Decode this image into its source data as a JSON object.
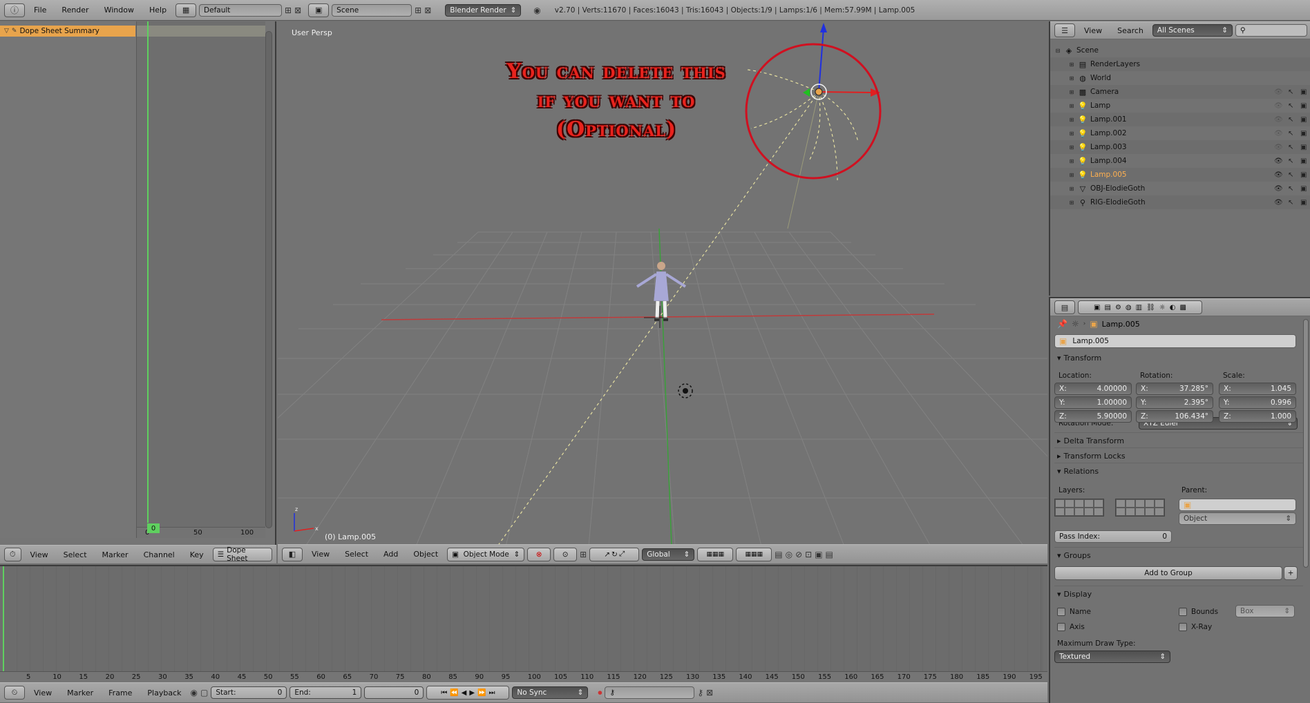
{
  "top_bar": {
    "menus": [
      "File",
      "Render",
      "Window",
      "Help"
    ],
    "screen_layout": "Default",
    "scene": "Scene",
    "render_engine": "Blender Render",
    "stats": "v2.70 | Verts:11670 | Faces:16043 | Tris:16043 | Objects:1/9 | Lamps:1/6 | Mem:57.99M | Lamp.005"
  },
  "dope_sheet": {
    "summary_label": "Dope Sheet Summary",
    "current_frame": "0",
    "ruler_ticks": [
      "0",
      "50",
      "100"
    ],
    "header_menus": [
      "View",
      "Select",
      "Marker",
      "Channel",
      "Key"
    ],
    "mode": "Dope Sheet"
  },
  "viewport": {
    "view_name": "User Persp",
    "object_label": "(0) Lamp.005",
    "callout_text": [
      "You can delete this",
      "if you want to",
      "(Optional)"
    ],
    "header_menus": [
      "View",
      "Select",
      "Add",
      "Object"
    ],
    "mode": "Object Mode",
    "transform_orientation": "Global"
  },
  "timeline": {
    "ruler_ticks": [
      "5",
      "10",
      "15",
      "20",
      "25",
      "30",
      "35",
      "40",
      "45",
      "50",
      "55",
      "60",
      "65",
      "70",
      "75",
      "80",
      "85",
      "90",
      "95",
      "100",
      "105",
      "110",
      "115",
      "120",
      "125",
      "130",
      "135",
      "140",
      "145",
      "150",
      "155",
      "160",
      "165",
      "170",
      "175",
      "180",
      "185",
      "190",
      "195"
    ],
    "header_menus": [
      "View",
      "Marker",
      "Frame",
      "Playback"
    ],
    "start_label": "Start:",
    "start_value": "0",
    "end_label": "End:",
    "end_value": "1",
    "current_frame": "0",
    "sync": "No Sync"
  },
  "outliner": {
    "header_menus": [
      "View",
      "Search"
    ],
    "scene_filter": "All Scenes",
    "items": [
      {
        "label": "Scene",
        "icon": "scene-icon",
        "indent": 0
      },
      {
        "label": "RenderLayers",
        "icon": "render-layers-icon",
        "indent": 1
      },
      {
        "label": "World",
        "icon": "world-icon",
        "indent": 1
      },
      {
        "label": "Camera",
        "icon": "camera-icon",
        "indent": 1
      },
      {
        "label": "Lamp",
        "icon": "lamp-icon",
        "indent": 1
      },
      {
        "label": "Lamp.001",
        "icon": "lamp-icon",
        "indent": 1
      },
      {
        "label": "Lamp.002",
        "icon": "lamp-icon",
        "indent": 1
      },
      {
        "label": "Lamp.003",
        "icon": "lamp-icon",
        "indent": 1
      },
      {
        "label": "Lamp.004",
        "icon": "lamp-icon",
        "indent": 1
      },
      {
        "label": "Lamp.005",
        "icon": "lamp-icon",
        "indent": 1,
        "selected": true
      },
      {
        "label": "OBJ-ElodieGoth",
        "icon": "mesh-icon",
        "indent": 1
      },
      {
        "label": "RIG-ElodieGoth",
        "icon": "armature-icon",
        "indent": 1
      }
    ]
  },
  "properties": {
    "breadcrumb_object": "Lamp.005",
    "object_name": "Lamp.005",
    "transform": {
      "title": "Transform",
      "location_label": "Location:",
      "rotation_label": "Rotation:",
      "scale_label": "Scale:",
      "location": [
        {
          "axis": "X:",
          "value": "4.00000"
        },
        {
          "axis": "Y:",
          "value": "1.00000"
        },
        {
          "axis": "Z:",
          "value": "5.90000"
        }
      ],
      "rotation": [
        {
          "axis": "X:",
          "value": "37.285°"
        },
        {
          "axis": "Y:",
          "value": "2.395°"
        },
        {
          "axis": "Z:",
          "value": "106.434°"
        }
      ],
      "scale": [
        {
          "axis": "X:",
          "value": "1.045"
        },
        {
          "axis": "Y:",
          "value": "0.996"
        },
        {
          "axis": "Z:",
          "value": "1.000"
        }
      ],
      "rotation_mode_label": "Rotation Mode:",
      "rotation_mode": "XYZ Euler"
    },
    "delta_transform": "Delta Transform",
    "transform_locks": "Transform Locks",
    "relations": {
      "title": "Relations",
      "layers_label": "Layers:",
      "parent_label": "Parent:",
      "parent_type": "Object",
      "pass_index_label": "Pass Index:",
      "pass_index": "0"
    },
    "groups": {
      "title": "Groups",
      "add_button": "Add to Group"
    },
    "display": {
      "title": "Display",
      "name": "Name",
      "axis": "Axis",
      "bounds": "Bounds",
      "bounds_type": "Box",
      "xray": "X-Ray",
      "max_draw_label": "Maximum Draw Type:",
      "max_draw_value": "Textured"
    }
  },
  "colors": {
    "selected_orange": "#e8a44c",
    "frame_green": "#5fd05f",
    "callout_red": "#e8231d",
    "x_axis": "#e02020",
    "y_axis": "#20c020",
    "z_axis": "#2030e0"
  }
}
